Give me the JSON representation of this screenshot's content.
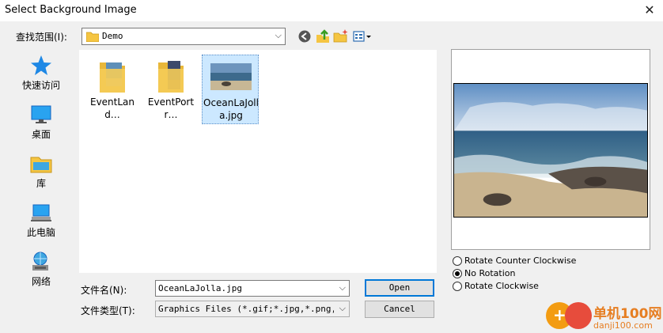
{
  "window": {
    "title": "Select Background Image",
    "close_glyph": "✕"
  },
  "lookin": {
    "label": "查找范围(I):",
    "value": "Demo"
  },
  "toolbar": {
    "icons": [
      "back-icon",
      "up-folder-icon",
      "new-folder-icon",
      "view-menu-icon"
    ]
  },
  "places": [
    {
      "label": "快速访问",
      "icon": "star-icon"
    },
    {
      "label": "桌面",
      "icon": "desktop-icon"
    },
    {
      "label": "库",
      "icon": "library-icon"
    },
    {
      "label": "此电脑",
      "icon": "computer-icon"
    },
    {
      "label": "网络",
      "icon": "network-icon"
    }
  ],
  "files": [
    {
      "name": "EventLand…",
      "icon": "landscape-folder-icon"
    },
    {
      "name": "EventPortr…",
      "icon": "portrait-folder-icon"
    },
    {
      "name": "OceanLaJolla.jpg",
      "icon": "image-thumbnail"
    }
  ],
  "rotation": {
    "options": [
      "Rotate Counter Clockwise",
      "No Rotation",
      "Rotate Clockwise"
    ],
    "selected": "No Rotation"
  },
  "filename": {
    "label": "文件名(N):",
    "value": "OceanLaJolla.jpg"
  },
  "filetype": {
    "label": "文件类型(T):",
    "value": "Graphics Files (*.gif;*.jpg,*.png,*.t"
  },
  "buttons": {
    "open": "Open",
    "cancel": "Cancel"
  },
  "watermark": {
    "line1": "单机100网",
    "line2": "danji100.com"
  },
  "colors": {
    "selection": "#cce8ff",
    "accent": "#0078d7"
  }
}
